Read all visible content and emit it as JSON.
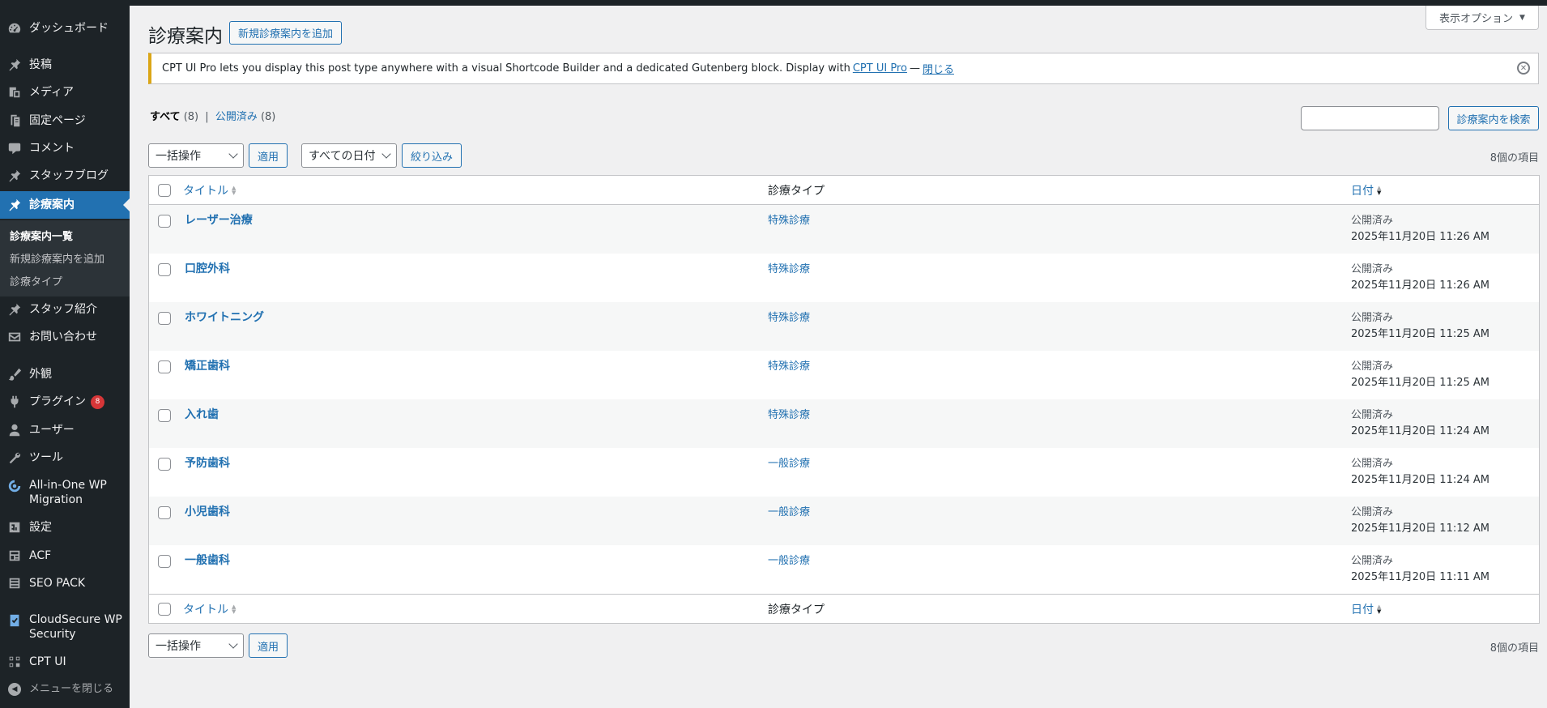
{
  "sidebar": {
    "items": [
      {
        "label": "ダッシュボード",
        "icon": "dashboard-icon"
      },
      {
        "label": "投稿",
        "icon": "pin-icon"
      },
      {
        "label": "メディア",
        "icon": "media-icon"
      },
      {
        "label": "固定ページ",
        "icon": "page-icon"
      },
      {
        "label": "コメント",
        "icon": "comment-icon"
      },
      {
        "label": "スタッフブログ",
        "icon": "pin-icon"
      },
      {
        "label": "診療案内",
        "icon": "pin-icon"
      },
      {
        "label": "スタッフ紹介",
        "icon": "pin-icon"
      },
      {
        "label": "お問い合わせ",
        "icon": "mail-icon"
      },
      {
        "label": "外観",
        "icon": "brush-icon"
      },
      {
        "label": "プラグイン",
        "icon": "plugin-icon",
        "badge": "8"
      },
      {
        "label": "ユーザー",
        "icon": "user-icon"
      },
      {
        "label": "ツール",
        "icon": "wrench-icon"
      },
      {
        "label": "All-in-One WP Migration",
        "icon": "migration-icon"
      },
      {
        "label": "設定",
        "icon": "settings-icon"
      },
      {
        "label": "ACF",
        "icon": "grid-icon"
      },
      {
        "label": "SEO PACK",
        "icon": "list-icon"
      },
      {
        "label": "CloudSecure WP Security",
        "icon": "shield-check-icon"
      },
      {
        "label": "CPT UI",
        "icon": "cptui-icon"
      }
    ],
    "submenu": [
      "診療案内一覧",
      "新規診療案内を追加",
      "診療タイプ"
    ],
    "collapse_label": "メニューを閉じる"
  },
  "header": {
    "title": "診療案内",
    "add_new": "新規診療案内を追加",
    "screen_options": "表示オプション"
  },
  "notice": {
    "text": "CPT UI Pro lets you display this post type anywhere with a visual Shortcode Builder and a dedicated Gutenberg block. Display with",
    "link": "CPT UI Pro",
    "dash": "—",
    "close": "閉じる"
  },
  "filters": {
    "all": "すべて",
    "all_count": "(8)",
    "sep": "|",
    "published": "公開済み",
    "published_count": "(8)",
    "search_button": "診療案内を検索",
    "bulk_action": "一括操作",
    "apply": "適用",
    "all_dates": "すべての日付",
    "filter": "絞り込み",
    "items_count": "8個の項目"
  },
  "table": {
    "columns": {
      "title": "タイトル",
      "type": "診療タイプ",
      "date": "日付"
    },
    "rows": [
      {
        "title": "レーザー治療",
        "type": "特殊診療",
        "status": "公開済み",
        "date": "2025年11月20日 11:26 AM"
      },
      {
        "title": "口腔外科",
        "type": "特殊診療",
        "status": "公開済み",
        "date": "2025年11月20日 11:26 AM"
      },
      {
        "title": "ホワイトニング",
        "type": "特殊診療",
        "status": "公開済み",
        "date": "2025年11月20日 11:25 AM"
      },
      {
        "title": "矯正歯科",
        "type": "特殊診療",
        "status": "公開済み",
        "date": "2025年11月20日 11:25 AM"
      },
      {
        "title": "入れ歯",
        "type": "特殊診療",
        "status": "公開済み",
        "date": "2025年11月20日 11:24 AM"
      },
      {
        "title": "予防歯科",
        "type": "一般診療",
        "status": "公開済み",
        "date": "2025年11月20日 11:24 AM"
      },
      {
        "title": "小児歯科",
        "type": "一般診療",
        "status": "公開済み",
        "date": "2025年11月20日 11:12 AM"
      },
      {
        "title": "一般歯科",
        "type": "一般診療",
        "status": "公開済み",
        "date": "2025年11月20日 11:11 AM"
      }
    ]
  },
  "colors": {
    "accent": "#2271b1",
    "sidebar_bg": "#1d2327",
    "notice_border": "#dba617",
    "badge": "#d63638"
  }
}
